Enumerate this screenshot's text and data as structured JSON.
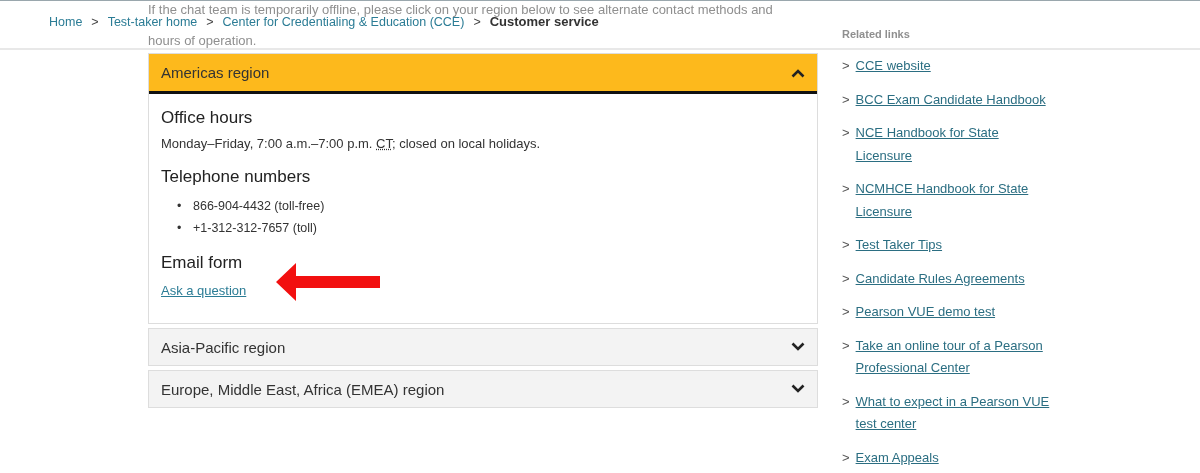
{
  "breadcrumb": [
    {
      "kind": "link",
      "label": "Home"
    },
    {
      "kind": "separator",
      "label": ">"
    },
    {
      "kind": "link",
      "label": "Test-taker home"
    },
    {
      "kind": "separator",
      "label": ">"
    },
    {
      "kind": "link",
      "label": "Center for Credentialing & Education (CCE)"
    },
    {
      "kind": "separator",
      "label": ">"
    },
    {
      "kind": "current",
      "label": "Customer service"
    }
  ],
  "intro_lines": [
    "If the chat team is temporarily offline, please click on your region below to see alternate contact methods and",
    "hours of operation."
  ],
  "accordion": [
    {
      "title": "Americas region",
      "expanded": true,
      "sections": [
        {
          "heading": "Office hours",
          "kind": "hours",
          "before": "Monday–Friday, 7:00 a.m.–7:00 p.m. ",
          "abbr": "CT",
          "after": "; closed on local holidays."
        },
        {
          "heading": "Telephone numbers",
          "kind": "list",
          "items": [
            {
              "marker": "•",
              "text": "866-904-4432 (toll-free)"
            },
            {
              "marker": "•",
              "text": "+1-312-312-7657 (toll)"
            }
          ]
        },
        {
          "heading": "Email form",
          "kind": "link",
          "link": "Ask a question"
        }
      ]
    },
    {
      "title": "Asia-Pacific region",
      "expanded": false
    },
    {
      "title": "Europe, Middle East, Africa (EMEA) region",
      "expanded": false
    }
  ],
  "sidebar": {
    "title": "Related links",
    "links": [
      {
        "marker": ">",
        "label": "CCE website"
      },
      {
        "marker": ">",
        "label": "BCC Exam Candidate Handbook"
      },
      {
        "marker": ">",
        "label": "NCE Handbook for State Licensure"
      },
      {
        "marker": ">",
        "label": "NCMHCE Handbook for State Licensure"
      },
      {
        "marker": ">",
        "label": "Test Taker Tips"
      },
      {
        "marker": ">",
        "label": "Candidate Rules Agreements"
      },
      {
        "marker": ">",
        "label": "Pearson VUE demo test"
      },
      {
        "marker": ">",
        "label": "Take an online tour of a Pearson Professional Center"
      },
      {
        "marker": ">",
        "label": "What to expect in a Pearson VUE test center"
      },
      {
        "marker": ">",
        "label": "Exam Appeals"
      }
    ]
  }
}
